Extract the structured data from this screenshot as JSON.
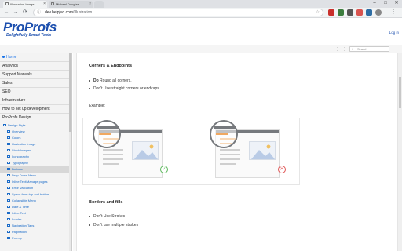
{
  "browser": {
    "tabs": [
      {
        "title": "Illustration Image",
        "active": true
      },
      {
        "title": "Micheal Douglas",
        "active": false
      }
    ],
    "window_controls": {
      "minimize": "–",
      "maximize": "□",
      "close": "✕"
    },
    "url_domain": "dev.helpjuq.com",
    "url_path": "/Illustration",
    "nav": {
      "back": "←",
      "forward": "→",
      "reload": "⟳"
    }
  },
  "header": {
    "logo_title": "ProProfs",
    "logo_tagline": "Delightfully Smart Tools",
    "login_label": "Log in"
  },
  "topstrip": {
    "search_placeholder": "Search"
  },
  "sidebar": {
    "top_items": [
      {
        "label": "Home",
        "active": true
      },
      {
        "label": "Analytics"
      },
      {
        "label": "Support Manuals"
      },
      {
        "label": "Sales"
      },
      {
        "label": "SEO"
      },
      {
        "label": "Infrastructure"
      },
      {
        "label": "How to set up development"
      },
      {
        "label": "ProProfs Design"
      }
    ],
    "design_group": "Design Style",
    "design_items": [
      "Overview",
      "Colors",
      "Illustration Image",
      "Stock Images",
      "Iconography",
      "Typography",
      "Buttons",
      "Drop Down Menu",
      "Inline Text/Manage pages",
      "Error Validation",
      "Space from top and bottom",
      "Collapsible Menu",
      "Date & Time",
      "Inline Text",
      "Loader",
      "Navigation Tabs",
      "Pagination",
      "Pop-up"
    ],
    "highlighted_item": "Buttons",
    "collapse_glyph": "◀"
  },
  "content": {
    "section1": {
      "title": "Corners & Endpoints",
      "items": [
        {
          "strong": "Do",
          "text": " Round all corners."
        },
        {
          "strong": "",
          "text": "Don't Use straight corners or endcaps."
        }
      ],
      "example_label": "Example:"
    },
    "section2": {
      "title": "Borders and fills",
      "items": [
        "Don't Use Strokes",
        "Don't use multiple strokes"
      ]
    },
    "example": {
      "ok_mark": "✓",
      "bad_mark": "✕"
    }
  },
  "colors": {
    "brand": "#1c4fae",
    "link": "#1a6bc8",
    "accent_orange": "#f0a860",
    "ok": "#5cb85c",
    "error": "#e05757"
  },
  "icons": [
    "page-icon",
    "lock-icon",
    "star-icon",
    "search-icon",
    "folder-icon",
    "check-icon",
    "cross-icon"
  ]
}
